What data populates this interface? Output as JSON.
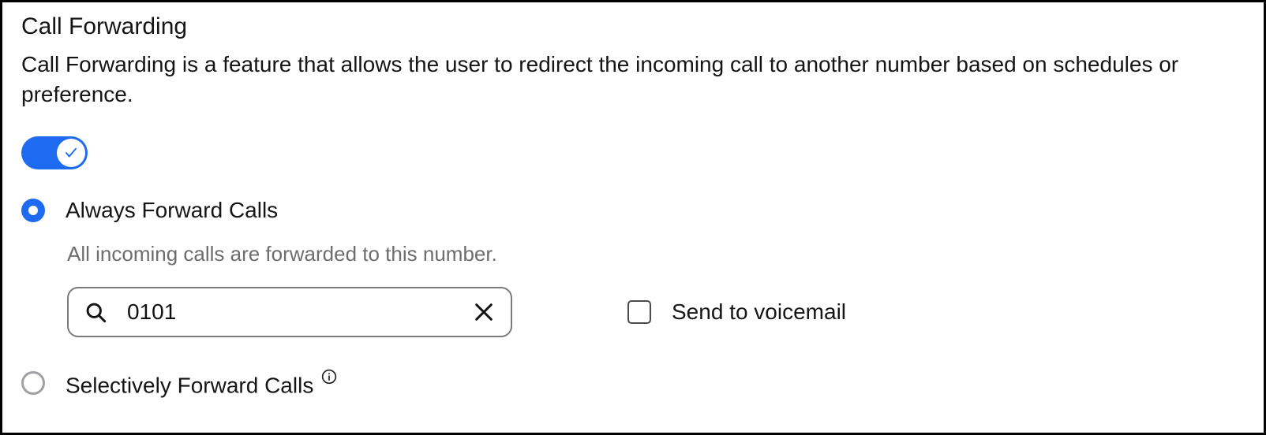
{
  "title": "Call Forwarding",
  "description": "Call Forwarding is a feature that allows the user to redirect the incoming call to another number based on schedules or preference.",
  "enabled": true,
  "options": {
    "always": {
      "label": "Always Forward Calls",
      "selected": true,
      "hint": "All incoming calls are forwarded to this number.",
      "number_value": "0101",
      "voicemail_label": "Send to voicemail",
      "voicemail_checked": false
    },
    "selective": {
      "label": "Selectively Forward Calls",
      "selected": false
    }
  },
  "icons": {
    "search": "search-icon",
    "clear": "close-icon",
    "info": "info-icon",
    "check": "check-icon"
  },
  "colors": {
    "accent": "#1e6af0"
  }
}
